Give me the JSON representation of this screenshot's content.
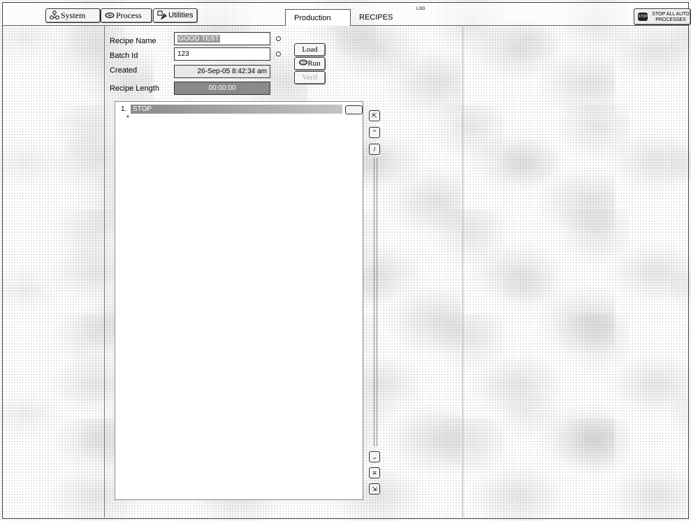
{
  "toolbar": {
    "system_label": "System",
    "process_label": "Process",
    "utilities_label": "Utilities"
  },
  "tabs": [
    {
      "label": "Production",
      "active": true
    },
    {
      "label": "RECIPES",
      "active": false
    }
  ],
  "log_label": "LOG",
  "stop_button": {
    "line1": "STOP ALL AUTO",
    "line2": "PROCESSES",
    "icon_text": "STOP"
  },
  "recipe": {
    "name_label": "Recipe Name",
    "name_value": "GOOD TEST",
    "batch_label": "Batch Id",
    "batch_value": "123",
    "created_label": "Created",
    "created_value": "26-Sep-05   8:42:34 am",
    "length_label": "Recipe Length",
    "length_value": "00:00:00"
  },
  "actions": {
    "load": "Load",
    "run": "Run",
    "verify": "Verif"
  },
  "steps": [
    {
      "number": "1.",
      "label": "STOP"
    }
  ],
  "new_row_marker": "*",
  "nav_icons": [
    "top-icon",
    "page-up-icon",
    "step-up-icon",
    "step-down-icon",
    "page-down-icon",
    "bottom-icon"
  ]
}
